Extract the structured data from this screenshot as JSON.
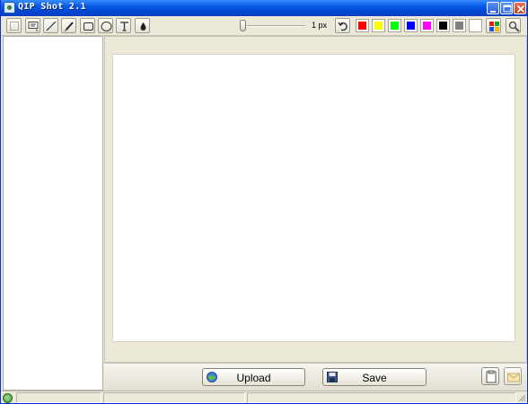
{
  "window": {
    "title": "QIP Shot 2.1",
    "controls": [
      "minimize-icon",
      "maximize-icon",
      "close-icon"
    ]
  },
  "toolbar": {
    "tools": [
      {
        "name": "select-tool",
        "icon": "rectangle-select-icon"
      },
      {
        "name": "text-frame-tool",
        "icon": "callout-icon"
      },
      {
        "name": "line-tool",
        "icon": "line-icon"
      },
      {
        "name": "pencil-tool",
        "icon": "pencil-icon"
      },
      {
        "name": "rectangle-tool",
        "icon": "rectangle-icon"
      },
      {
        "name": "ellipse-tool",
        "icon": "ellipse-icon"
      },
      {
        "name": "text-tool",
        "icon": "text-t-icon"
      },
      {
        "name": "fill-tool",
        "icon": "drop-icon"
      }
    ],
    "line_width_label": "1 px",
    "line_width_value": 1,
    "undo_icon": "undo-icon",
    "colors": [
      "#ff0000",
      "#ffff00",
      "#00ff00",
      "#0000ff",
      "#ff00ff",
      "#000000",
      "#808080",
      "#ffffff"
    ],
    "palette_icon": "palette-icon",
    "settings_icon": "settings-icon"
  },
  "actions": {
    "upload_label": "Upload",
    "upload_icon": "globe-icon",
    "save_label": "Save",
    "save_icon": "floppy-disk-icon",
    "copy_icon": "clipboard-icon",
    "mail_icon": "envelope-icon"
  },
  "statusbar": {
    "status_icon": "status-online-icon"
  }
}
